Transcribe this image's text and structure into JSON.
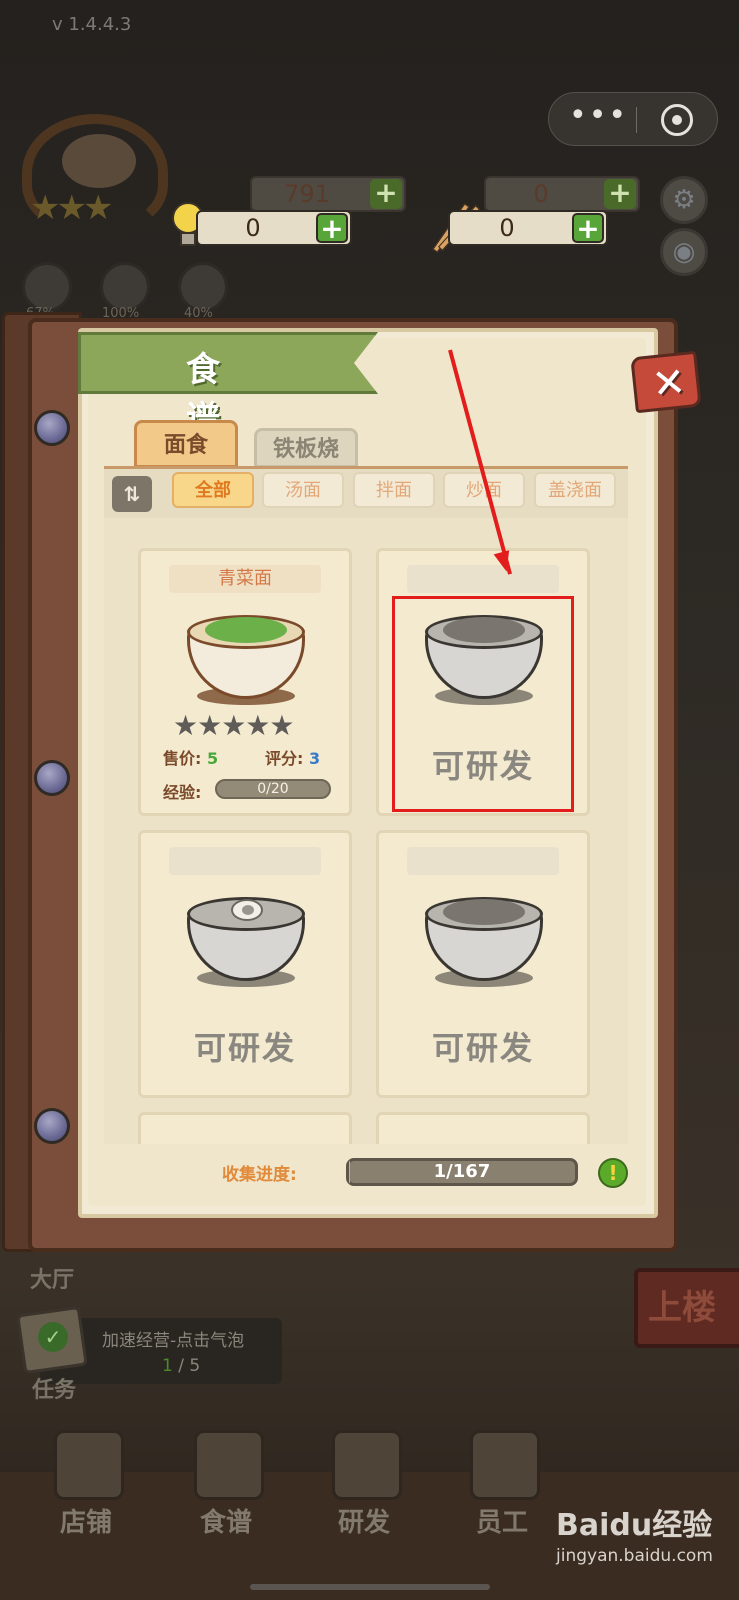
{
  "status": {
    "version": "v 1.4.4.3"
  },
  "miniprogram": {
    "more_icon": "more-dots-icon",
    "close_icon": "target-circle-icon"
  },
  "resources": {
    "coins": "791",
    "gems": "0",
    "ideas": "0",
    "chopsticks": "0"
  },
  "stats": [
    {
      "label": "67%"
    },
    {
      "label": "100%"
    },
    {
      "label": "40%"
    }
  ],
  "modal": {
    "title": "食谱",
    "category_tabs": [
      {
        "label": "面食",
        "active": true
      },
      {
        "label": "铁板烧",
        "active": false
      }
    ],
    "sort_icon": "sort-icon",
    "filters": [
      {
        "label": "全部",
        "active": true
      },
      {
        "label": "汤面",
        "active": false
      },
      {
        "label": "拌面",
        "active": false
      },
      {
        "label": "炒面",
        "active": false
      },
      {
        "label": "盖浇面",
        "active": false
      }
    ],
    "recipes": [
      {
        "name": "青菜面",
        "state": "unlocked",
        "stars": "★★★★★",
        "price_label": "售价:",
        "price": "5",
        "score_label": "评分:",
        "score": "3",
        "exp_label": "经验:",
        "exp": "0/20"
      },
      {
        "name": "",
        "state": "locked",
        "action": "可研发"
      },
      {
        "name": "",
        "state": "locked",
        "action": "可研发"
      },
      {
        "name": "",
        "state": "locked",
        "action": "可研发"
      }
    ],
    "progress_label": "收集进度:",
    "progress_text": "1/167",
    "progress_fraction": 0.006,
    "hint_icon": "!"
  },
  "hud": {
    "hall_label": "大厅",
    "task_title": "加速经营-点击气泡",
    "task_done": "1",
    "task_total": " / 5",
    "task_label": "任务",
    "upstairs": "上楼"
  },
  "nav": [
    {
      "label": "店铺"
    },
    {
      "label": "食谱"
    },
    {
      "label": "研发"
    },
    {
      "label": "员工"
    }
  ],
  "watermark": {
    "logo": "Baidu经验",
    "url": "jingyan.baidu.com"
  },
  "colors": {
    "accent_green": "#8ca65a",
    "close_red": "#c64a3a",
    "highlight_red": "#e31c1c",
    "price_green": "#4aa83a",
    "score_blue": "#3a7ac8"
  }
}
